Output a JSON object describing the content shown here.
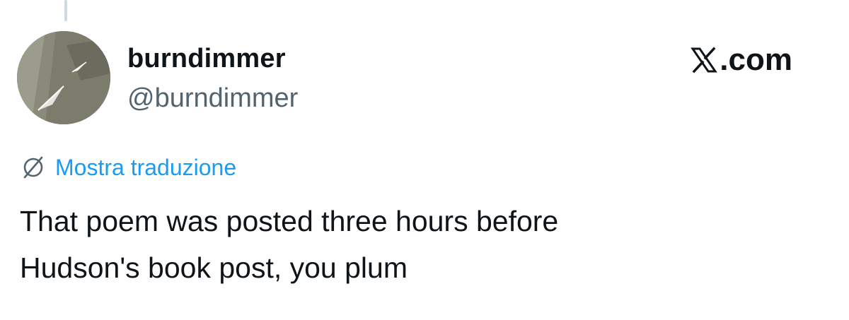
{
  "user": {
    "display_name": "burndimmer",
    "handle": "@burndimmer",
    "avatar_icon": "paper-plane-photo-icon"
  },
  "brand": {
    "label": ".com",
    "logo_icon": "x-logo-icon"
  },
  "translate": {
    "label": "Mostra traduzione",
    "icon": "globe-icon",
    "color": "#1d9bf0"
  },
  "tweet": {
    "lines": [
      "That poem was posted three hours before",
      "Hudson's book post, you plum"
    ]
  }
}
